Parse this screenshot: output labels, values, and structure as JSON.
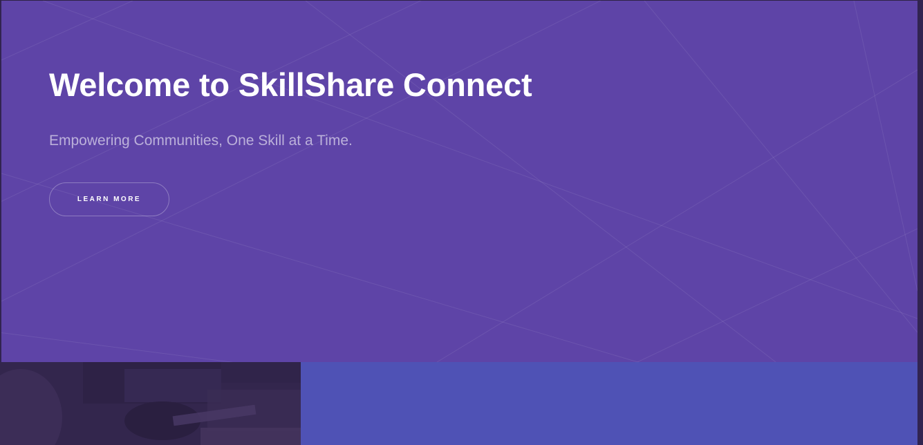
{
  "banner": {
    "title": "Welcome to SkillShare Connect",
    "subtitle": "Empowering Communities, One Skill at a Time.",
    "button_label": "LEARN MORE"
  },
  "colors": {
    "banner_background": "#5e44a7",
    "secondary_panel": "#4f52b5",
    "page_background": "#312450",
    "text_primary": "#ffffff"
  }
}
